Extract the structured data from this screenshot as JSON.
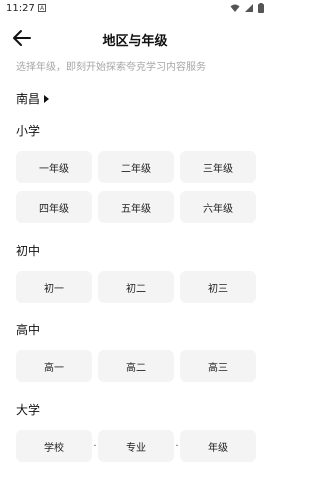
{
  "status_bar": {
    "time": "11:27",
    "notification_glyph": "A"
  },
  "header": {
    "title": "地区与年级"
  },
  "subtitle": "选择年级，即刻开始探索夸克学习内容服务",
  "region": {
    "label": "南昌"
  },
  "sections": {
    "primary": {
      "title": "小学",
      "grades": [
        "一年级",
        "二年级",
        "三年级",
        "四年级",
        "五年级",
        "六年级"
      ]
    },
    "junior": {
      "title": "初中",
      "grades": [
        "初一",
        "初二",
        "初三"
      ]
    },
    "senior": {
      "title": "高中",
      "grades": [
        "高一",
        "高二",
        "高三"
      ]
    },
    "college": {
      "title": "大学",
      "fields": [
        "学校",
        "专业",
        "年级"
      ],
      "separator": "·"
    }
  }
}
